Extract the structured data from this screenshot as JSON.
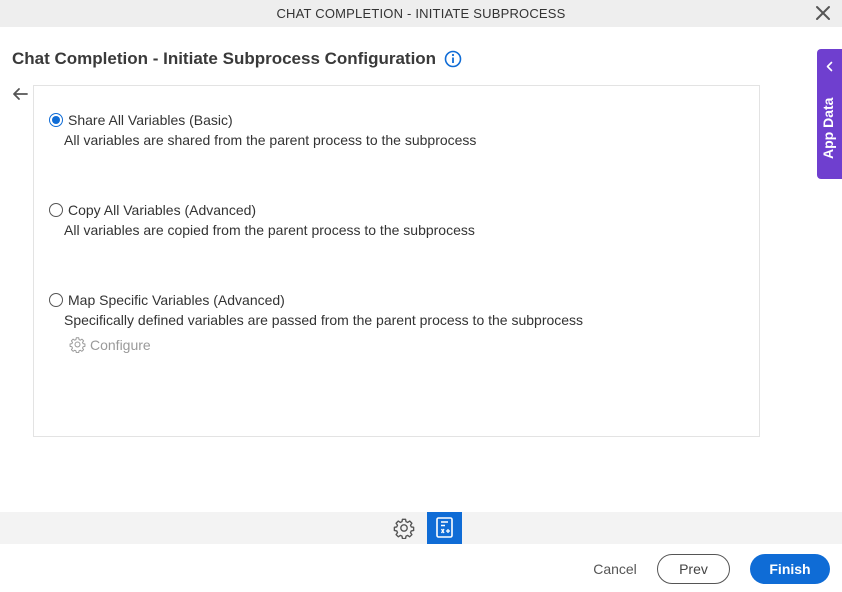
{
  "window": {
    "title": "CHAT COMPLETION - INITIATE SUBPROCESS"
  },
  "page": {
    "heading": "Chat Completion - Initiate Subprocess Configuration"
  },
  "options": [
    {
      "label": "Share All Variables (Basic)",
      "description": "All variables are shared from the parent process to the subprocess",
      "selected": true
    },
    {
      "label": "Copy All Variables (Advanced)",
      "description": "All variables are copied from the parent process to the subprocess",
      "selected": false
    },
    {
      "label": "Map Specific Variables (Advanced)",
      "description": "Specifically defined variables are passed from the parent process to the subprocess",
      "selected": false
    }
  ],
  "configure": {
    "label": "Configure",
    "enabled": false
  },
  "side_panel": {
    "label": "App Data"
  },
  "footer": {
    "cancel": "Cancel",
    "prev": "Prev",
    "finish": "Finish"
  },
  "colors": {
    "accent": "#0f6cd6",
    "side_panel": "#6f3fcf",
    "toolbar_bg": "#f3f3f3",
    "titlebar_bg": "#eeeeee"
  },
  "icons": {
    "close": "close-icon",
    "info": "info-icon",
    "back": "arrow-left-icon",
    "configure": "gear-icon",
    "side_panel": "chevron-left-icon",
    "toolbar_settings": "gear-icon",
    "toolbar_active": "document-variables-icon"
  }
}
